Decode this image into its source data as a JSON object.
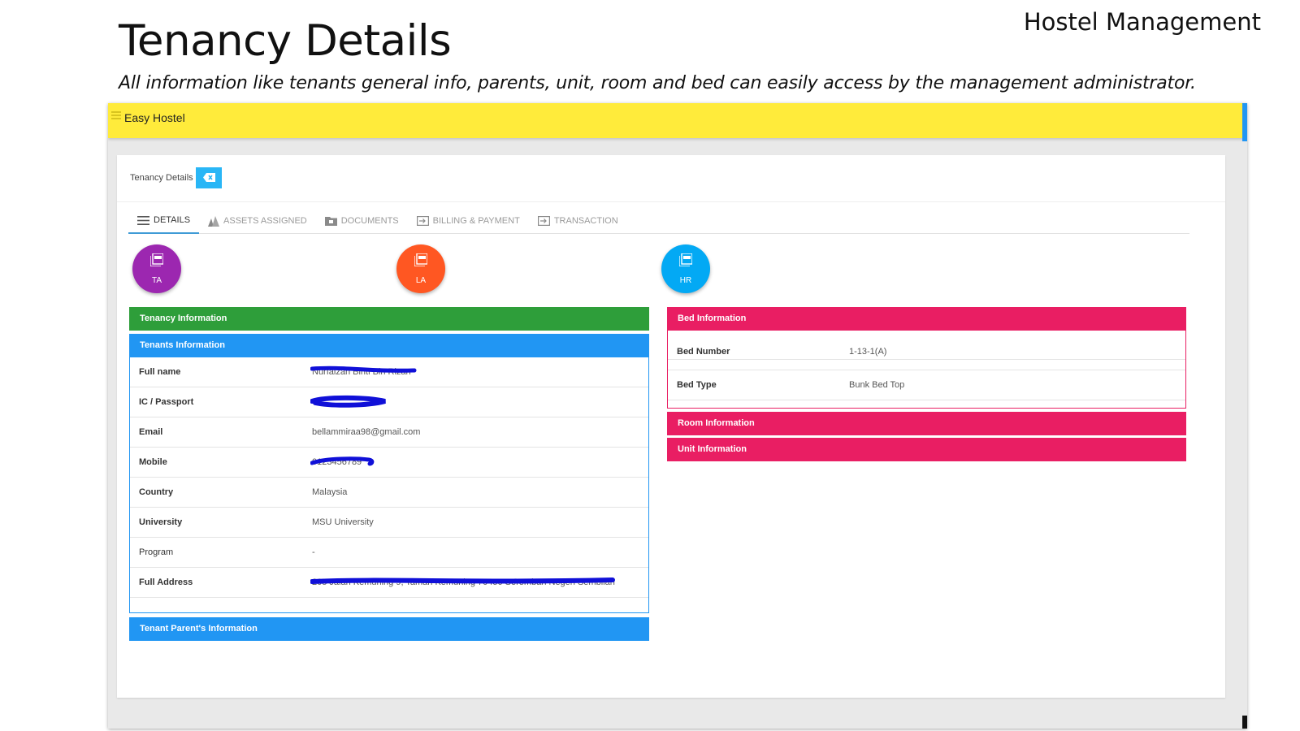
{
  "slide": {
    "brand": "Hostel Management",
    "title": "Tenancy Details",
    "subtitle": "All information like tenants general info, parents, unit, room and bed can easily access by the management administrator."
  },
  "app": {
    "name": "Easy Hostel",
    "accent_color": "#ffeb3b"
  },
  "card": {
    "title": "Tenancy Details",
    "close_icon": "backspace-icon"
  },
  "tabs": [
    {
      "label": "DETAILS",
      "icon": "list-icon",
      "active": true
    },
    {
      "label": "ASSETS ASSIGNED",
      "icon": "assets-icon",
      "active": false
    },
    {
      "label": "DOCUMENTS",
      "icon": "folder-icon",
      "active": false
    },
    {
      "label": "BILLING & PAYMENT",
      "icon": "input-icon",
      "active": false
    },
    {
      "label": "TRANSACTION",
      "icon": "input-icon",
      "active": false
    }
  ],
  "documents": [
    {
      "label": "TA",
      "icon": "pdf-icon",
      "color": "#9c27b0"
    },
    {
      "label": "LA",
      "icon": "pdf-icon",
      "color": "#ff5722"
    },
    {
      "label": "HR",
      "icon": "pdf-icon",
      "color": "#03a9f4"
    }
  ],
  "tenancy": {
    "section_title": "Tenancy Information",
    "tenants_title": "Tenants Information",
    "fields": [
      {
        "label": "Full name",
        "value": "Nurfaizah Binti Bin Rizan",
        "redacted": true
      },
      {
        "label": "IC / Passport",
        "value": "",
        "redacted": true
      },
      {
        "label": "Email",
        "value": "bellammiraa98@gmail.com",
        "redacted": false
      },
      {
        "label": "Mobile",
        "value": "0123456789",
        "redacted": true
      },
      {
        "label": "Country",
        "value": "Malaysia",
        "redacted": false
      },
      {
        "label": "University",
        "value": "MSU University",
        "redacted": false
      },
      {
        "label": "Program",
        "value": "-",
        "redacted": false
      },
      {
        "label": "Full Address",
        "value": "205 Jalan Kemuning 9, Taman Kemuning 70450 Seremban Negeri Sembilan",
        "redacted": true
      }
    ],
    "parents_title": "Tenant Parent's Information"
  },
  "bed": {
    "section_title": "Bed Information",
    "fields": [
      {
        "label": "Bed Number",
        "value": "1-13-1(A)"
      },
      {
        "label": "Bed Type",
        "value": "Bunk Bed Top"
      }
    ]
  },
  "room": {
    "section_title": "Room Information"
  },
  "unit": {
    "section_title": "Unit Information"
  },
  "colors": {
    "tenancy": "#2e9e3a",
    "tenants": "#2196f3",
    "bed": "#e91e63",
    "redaction": "#1010d8"
  }
}
